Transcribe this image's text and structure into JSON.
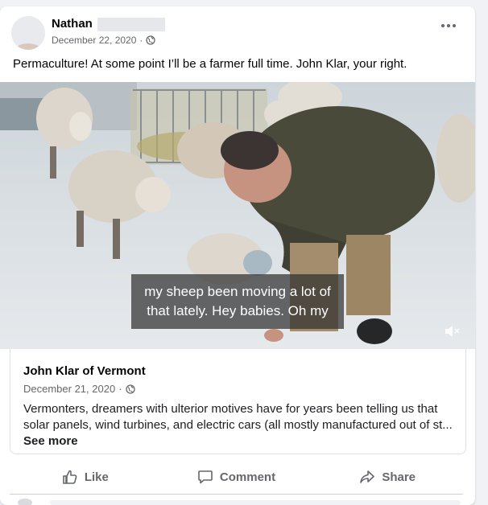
{
  "post": {
    "author": "Nathan",
    "date": "December 22, 2020",
    "date_separator": "·",
    "privacy_icon": "globe-icon",
    "text": "Permaculture! At some point I’ll be a farmer full time. John Klar, your right."
  },
  "video": {
    "caption_line1": "my sheep been moving a lot of",
    "caption_line2": "that lately. Hey babies. Oh my",
    "mute_icon": "speaker-muted-icon"
  },
  "shared_link": {
    "title": "John Klar of Vermont",
    "date": "December 21, 2020",
    "date_separator": "·",
    "description": "Vermonters, dreamers with ulterior motives have for years been telling us that solar panels, wind turbines, and electric cars (all mostly manufactured out of st...",
    "see_more": "See more"
  },
  "actions": {
    "like": "Like",
    "comment": "Comment",
    "share": "Share"
  },
  "colors": {
    "card_bg": "#ffffff",
    "page_bg": "#f0f2f5",
    "secondary_text": "#65676b",
    "caption_bg": "rgba(48,48,48,0.72)"
  }
}
